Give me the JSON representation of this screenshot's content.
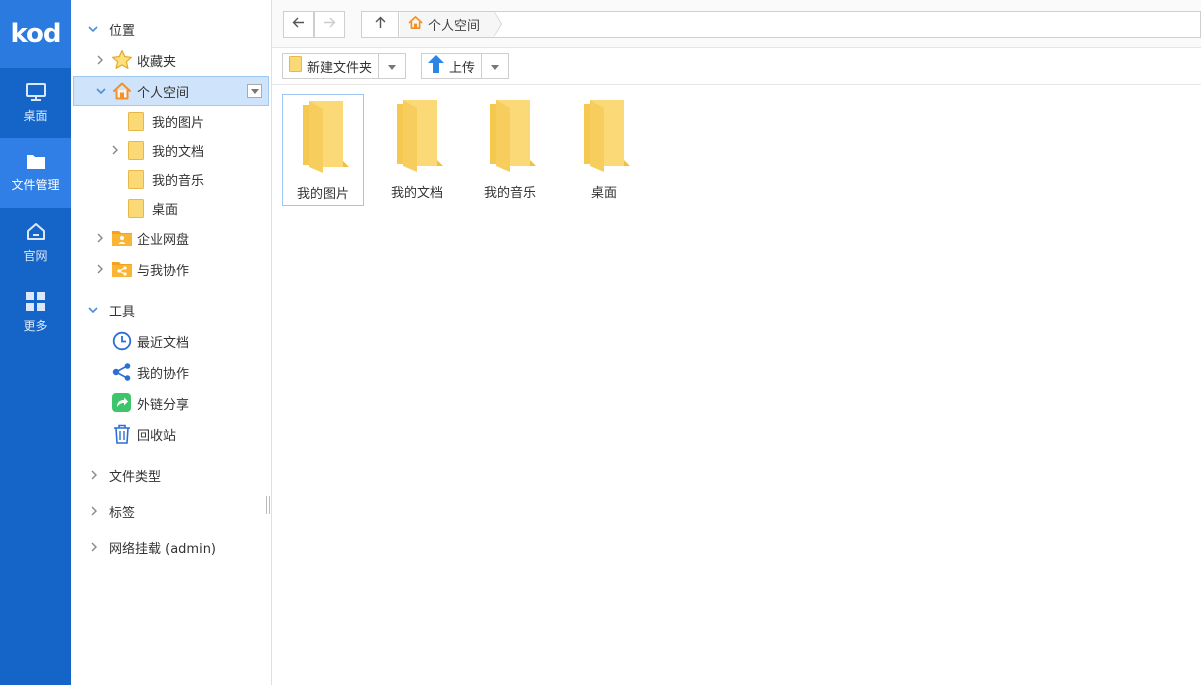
{
  "app": {
    "logo_text": "kod",
    "accent": "#1565c9",
    "selected_bg": "#cfe4fb"
  },
  "rail": {
    "items": [
      {
        "label": "桌面",
        "icon": "monitor-icon"
      },
      {
        "label": "文件管理",
        "icon": "folder-icon",
        "active": true
      },
      {
        "label": "官网",
        "icon": "home-icon"
      },
      {
        "label": "更多",
        "icon": "grid-icon"
      }
    ]
  },
  "tree": {
    "sections": {
      "location": "位置",
      "tools": "工具",
      "file_types": "文件类型",
      "tags": "标签",
      "network": "网络挂载 (admin)"
    },
    "location_items": {
      "favorites": "收藏夹",
      "personal": "个人空间",
      "my_pictures": "我的图片",
      "my_documents": "我的文档",
      "my_music": "我的音乐",
      "desktop": "桌面",
      "enterprise": "企业网盘",
      "shared_with_me": "与我协作"
    },
    "tool_items": {
      "recent": "最近文档",
      "my_collab": "我的协作",
      "external_share": "外链分享",
      "recycle": "回收站"
    }
  },
  "navbar": {
    "breadcrumb": [
      "个人空间"
    ]
  },
  "toolbar": {
    "new_folder": "新建文件夹",
    "upload": "上传"
  },
  "files": [
    {
      "name": "我的图片",
      "selected": true
    },
    {
      "name": "我的文档"
    },
    {
      "name": "我的音乐"
    },
    {
      "name": "桌面"
    }
  ]
}
